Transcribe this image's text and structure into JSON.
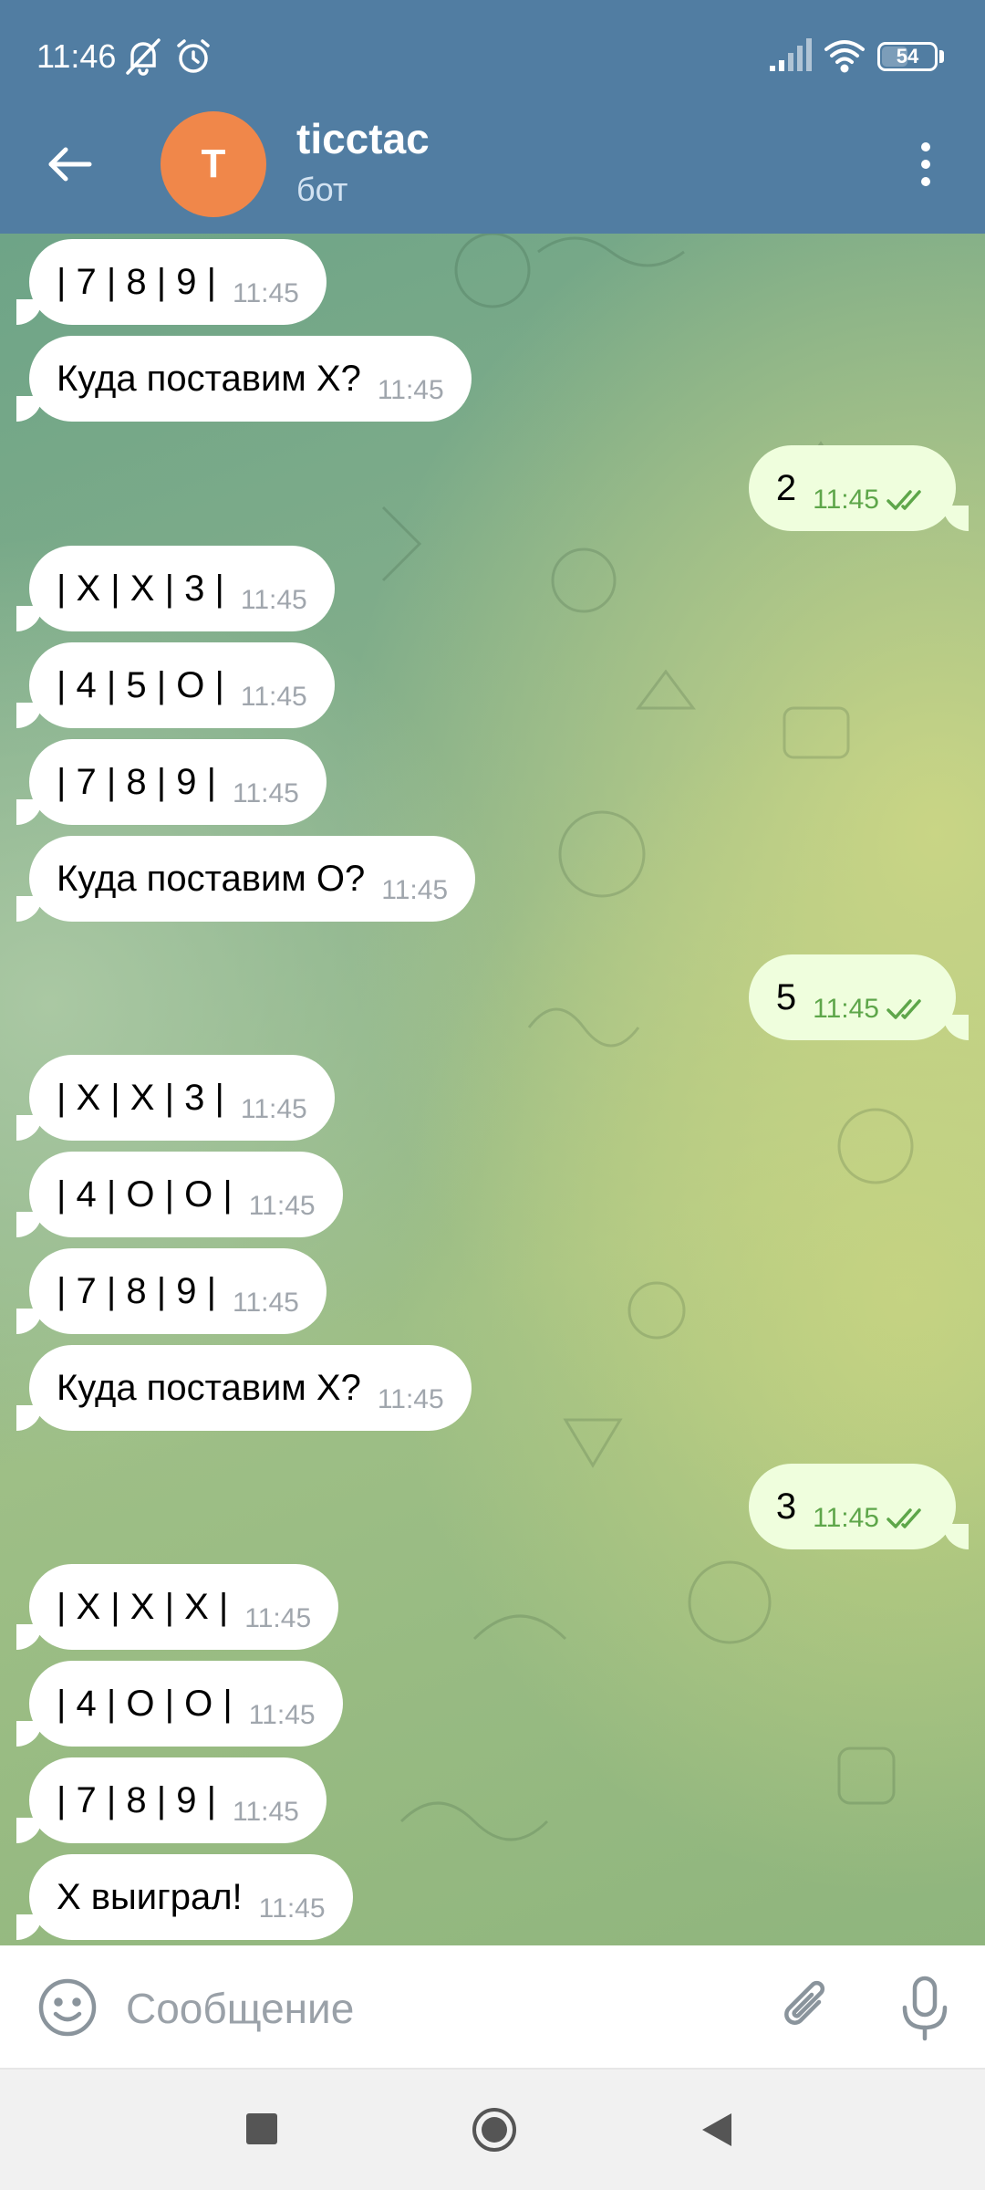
{
  "status_bar": {
    "time": "11:46",
    "battery": "54",
    "battery_level": 0.54,
    "icons": [
      "notifications-muted-icon",
      "alarm-icon",
      "signal-icon",
      "wifi-icon",
      "battery-icon"
    ]
  },
  "header": {
    "back_icon": "arrow-left-icon",
    "avatar_letter": "T",
    "avatar_color": "#f0874a",
    "name": "ticctac",
    "subtitle": "бот",
    "menu_icon": "more-vertical-icon"
  },
  "messages": [
    {
      "dir": "in",
      "text": "| 7 | 8 | 9 |",
      "time": "11:45"
    },
    {
      "dir": "in",
      "text": "Куда поставим X?",
      "time": "11:45"
    },
    {
      "dir": "out",
      "text": "2",
      "time": "11:45"
    },
    {
      "dir": "in",
      "text": "| X | X | 3 |",
      "time": "11:45"
    },
    {
      "dir": "in",
      "text": "| 4 | 5 | O |",
      "time": "11:45"
    },
    {
      "dir": "in",
      "text": "| 7 | 8 | 9 |",
      "time": "11:45"
    },
    {
      "dir": "in",
      "text": "Куда поставим O?",
      "time": "11:45"
    },
    {
      "dir": "out",
      "text": "5",
      "time": "11:45"
    },
    {
      "dir": "in",
      "text": "| X | X | 3 |",
      "time": "11:45"
    },
    {
      "dir": "in",
      "text": "| 4 | O | O |",
      "time": "11:45"
    },
    {
      "dir": "in",
      "text": "| 7 | 8 | 9 |",
      "time": "11:45"
    },
    {
      "dir": "in",
      "text": "Куда поставим X?",
      "time": "11:45"
    },
    {
      "dir": "out",
      "text": "3",
      "time": "11:45"
    },
    {
      "dir": "in",
      "text": "| X | X | X |",
      "time": "11:45"
    },
    {
      "dir": "in",
      "text": "| 4 | O | O |",
      "time": "11:45"
    },
    {
      "dir": "in",
      "text": "| 7 | 8 | 9 |",
      "time": "11:45"
    },
    {
      "dir": "in",
      "text": "X выиграл!",
      "time": "11:45"
    }
  ],
  "composer": {
    "placeholder": "Сообщение",
    "emoji_icon": "emoji-icon",
    "attach_icon": "paperclip-icon",
    "mic_icon": "microphone-icon"
  },
  "colors": {
    "header": "#517da2",
    "incoming_bubble": "#ffffff",
    "outgoing_bubble": "#effedd",
    "outgoing_time": "#5ea64a"
  }
}
